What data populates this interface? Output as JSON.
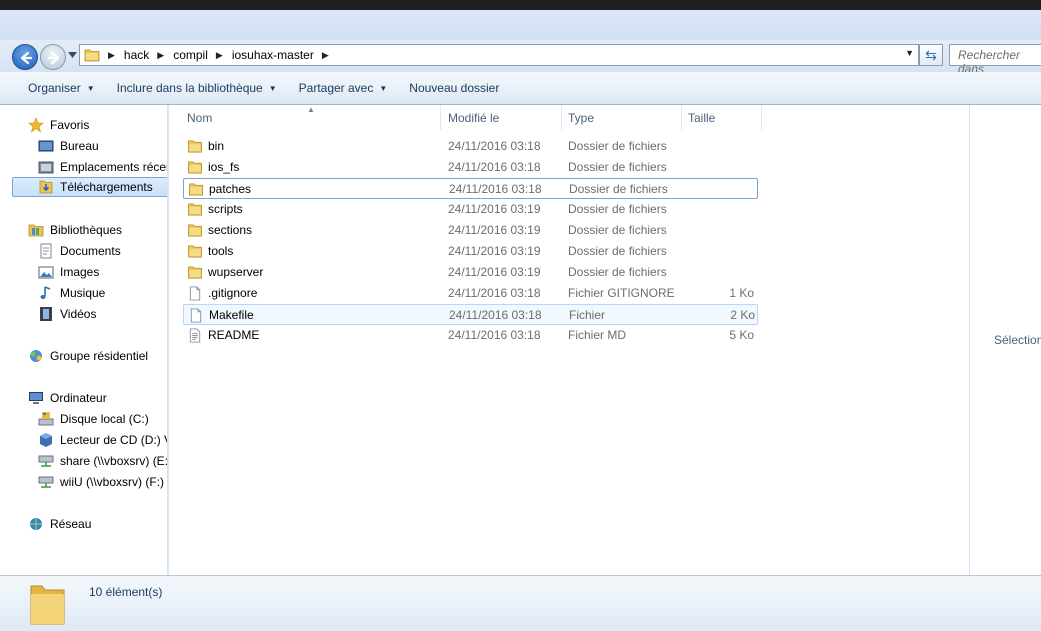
{
  "address_bar": {
    "crumbs": [
      "hack",
      "compil",
      "iosuhax-master"
    ],
    "search_placeholder": "Rechercher dans"
  },
  "toolbar": {
    "organize": "Organiser",
    "include_library": "Inclure dans la bibliothèque",
    "share_with": "Partager avec",
    "new_folder": "Nouveau dossier"
  },
  "nav_pane": {
    "favorites": "Favoris",
    "desktop": "Bureau",
    "recent_places": "Emplacements récer",
    "downloads": "Téléchargements",
    "libraries": "Bibliothèques",
    "documents": "Documents",
    "images": "Images",
    "music": "Musique",
    "videos": "Vidéos",
    "homegroup": "Groupe résidentiel",
    "computer": "Ordinateur",
    "local_disk": "Disque local (C:)",
    "cd_drive": "Lecteur de CD (D:) V",
    "share_drive": "share (\\\\vboxsrv) (E:",
    "wiiu_drive": "wiiU (\\\\vboxsrv) (F:)",
    "network": "Réseau"
  },
  "columns": {
    "name": "Nom",
    "modified": "Modifié le",
    "type": "Type",
    "size": "Taille"
  },
  "files": [
    {
      "name": "bin",
      "modified": "24/11/2016 03:18",
      "type": "Dossier de fichiers",
      "size": "",
      "icon": "folder-icon"
    },
    {
      "name": "ios_fs",
      "modified": "24/11/2016 03:18",
      "type": "Dossier de fichiers",
      "size": "",
      "icon": "folder-icon"
    },
    {
      "name": "patches",
      "modified": "24/11/2016 03:18",
      "type": "Dossier de fichiers",
      "size": "",
      "icon": "folder-icon"
    },
    {
      "name": "scripts",
      "modified": "24/11/2016 03:19",
      "type": "Dossier de fichiers",
      "size": "",
      "icon": "folder-icon"
    },
    {
      "name": "sections",
      "modified": "24/11/2016 03:19",
      "type": "Dossier de fichiers",
      "size": "",
      "icon": "folder-icon"
    },
    {
      "name": "tools",
      "modified": "24/11/2016 03:19",
      "type": "Dossier de fichiers",
      "size": "",
      "icon": "folder-icon"
    },
    {
      "name": "wupserver",
      "modified": "24/11/2016 03:19",
      "type": "Dossier de fichiers",
      "size": "",
      "icon": "folder-icon"
    },
    {
      "name": ".gitignore",
      "modified": "24/11/2016 03:18",
      "type": "Fichier GITIGNORE",
      "size": "1 Ko",
      "icon": "file-icon"
    },
    {
      "name": "Makefile",
      "modified": "24/11/2016 03:18",
      "type": "Fichier",
      "size": "2 Ko",
      "icon": "file-icon"
    },
    {
      "name": "README",
      "modified": "24/11/2016 03:18",
      "type": "Fichier MD",
      "size": "5 Ko",
      "icon": "text-file-icon"
    }
  ],
  "preview": {
    "message": "Sélection"
  },
  "status": {
    "count": "10 élément(s)"
  }
}
